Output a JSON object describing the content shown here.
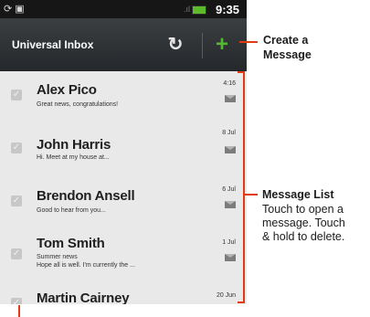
{
  "status_bar": {
    "time": "9:35"
  },
  "header": {
    "title": "Universal Inbox"
  },
  "messages": [
    {
      "name": "Alex Pico",
      "preview": "Great news, congratulations!",
      "preview2": "",
      "date": "4:16"
    },
    {
      "name": "John Harris",
      "preview": "Hi. Meet at my house at...",
      "preview2": "",
      "date": "8 Jul"
    },
    {
      "name": "Brendon Ansell",
      "preview": "Good to hear from you...",
      "preview2": "",
      "date": "6 Jul"
    },
    {
      "name": "Tom Smith",
      "preview": "Summer news",
      "preview2": "Hope all is well. I'm currently the ...",
      "date": "1 Jul"
    },
    {
      "name": "Martin Cairney",
      "preview": "",
      "preview2": "",
      "date": "20 Jun"
    }
  ],
  "annotations": {
    "create_title_1": "Create a",
    "create_title_2": "Message",
    "list_title": "Message List",
    "list_desc_1": "Touch to open a",
    "list_desc_2": "message. Touch",
    "list_desc_3": "& hold to delete."
  },
  "colors": {
    "accent_green": "#54b832",
    "callout_red": "#e23b12"
  }
}
